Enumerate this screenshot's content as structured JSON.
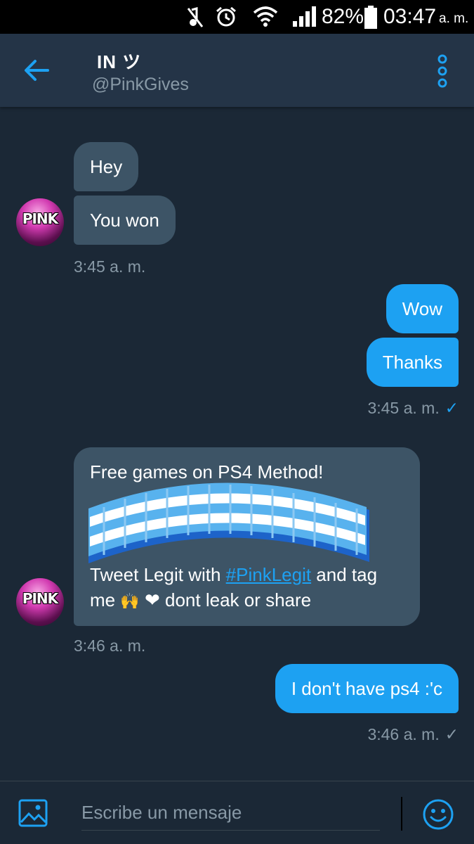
{
  "status_bar": {
    "battery": "82%",
    "time": "03:47",
    "ampm": "a. m.",
    "icons": [
      "mute-icon",
      "alarm-icon",
      "wifi-icon",
      "signal-icon",
      "battery-icon"
    ]
  },
  "header": {
    "name": "IN ツ",
    "handle": "@PinkGives",
    "icons": [
      "back-arrow-icon",
      "more-vertical-icon"
    ]
  },
  "messages": {
    "m1": {
      "text": "Hey"
    },
    "m2": {
      "text": "You won"
    },
    "t1": {
      "time": "3:45 a. m."
    },
    "m3": {
      "text": "Wow"
    },
    "m4": {
      "text": "Thanks"
    },
    "t2": {
      "time": "3:45 a. m.",
      "status": "✓"
    },
    "m5": {
      "line1": "Free games on PS4 Method!",
      "line2_before": "Tweet Legit with ",
      "hashtag": "#PinkLegit",
      "line2_after": " and tag",
      "line3_before": "me ",
      "emoji1": "🙌",
      "emoji2": "❤",
      "line3_after": " dont leak or share"
    },
    "t3": {
      "time": "3:46 a. m."
    },
    "m6": {
      "text": "I don't have ps4 :'c"
    },
    "t4": {
      "time": "3:46 a. m.",
      "status": "✓"
    }
  },
  "avatar_text": "PINK",
  "composer": {
    "placeholder": "Escribe un mensaje",
    "icons": [
      "image-icon",
      "emoji-icon"
    ]
  },
  "colors": {
    "background": "#1b2836",
    "header": "#243447",
    "incoming_bubble": "#3d5466",
    "outgoing_bubble": "#1da1f2",
    "muted_text": "#8899a6",
    "accent": "#1da1f2"
  }
}
